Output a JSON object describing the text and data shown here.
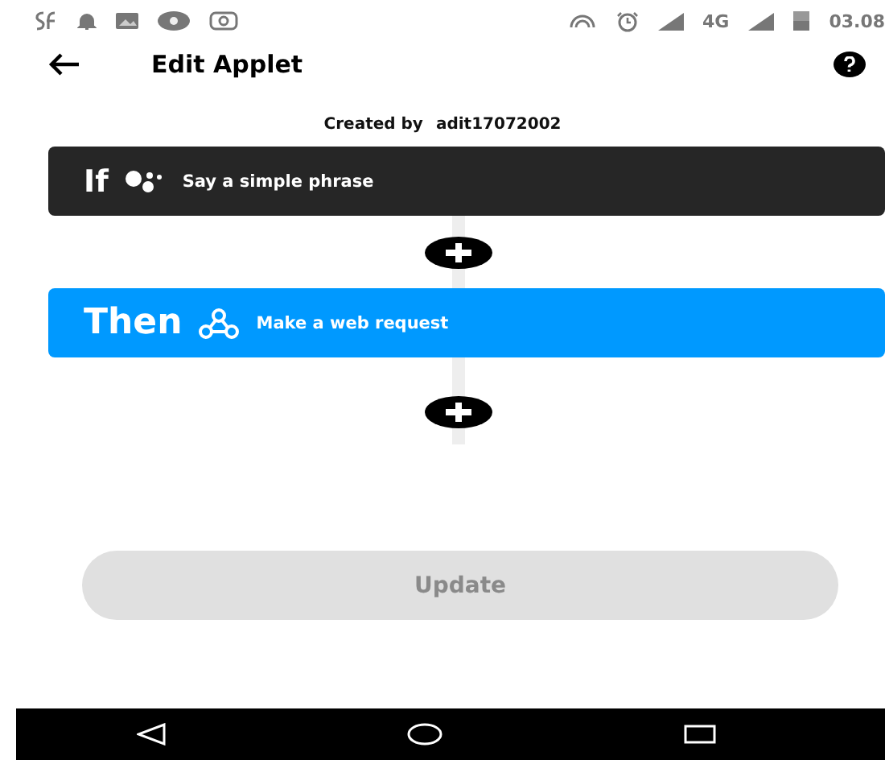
{
  "status_bar": {
    "network": "4G",
    "time": "03.08"
  },
  "header": {
    "title": "Edit Applet"
  },
  "created_by": {
    "label": "Created by",
    "author": "adit17072002"
  },
  "steps": [
    {
      "kind": "if",
      "keyword": "If",
      "text": "Say a simple phrase"
    },
    {
      "kind": "then",
      "keyword": "Then",
      "text": "Make a web request"
    }
  ],
  "update_button": {
    "label": "Update",
    "disabled": true
  }
}
